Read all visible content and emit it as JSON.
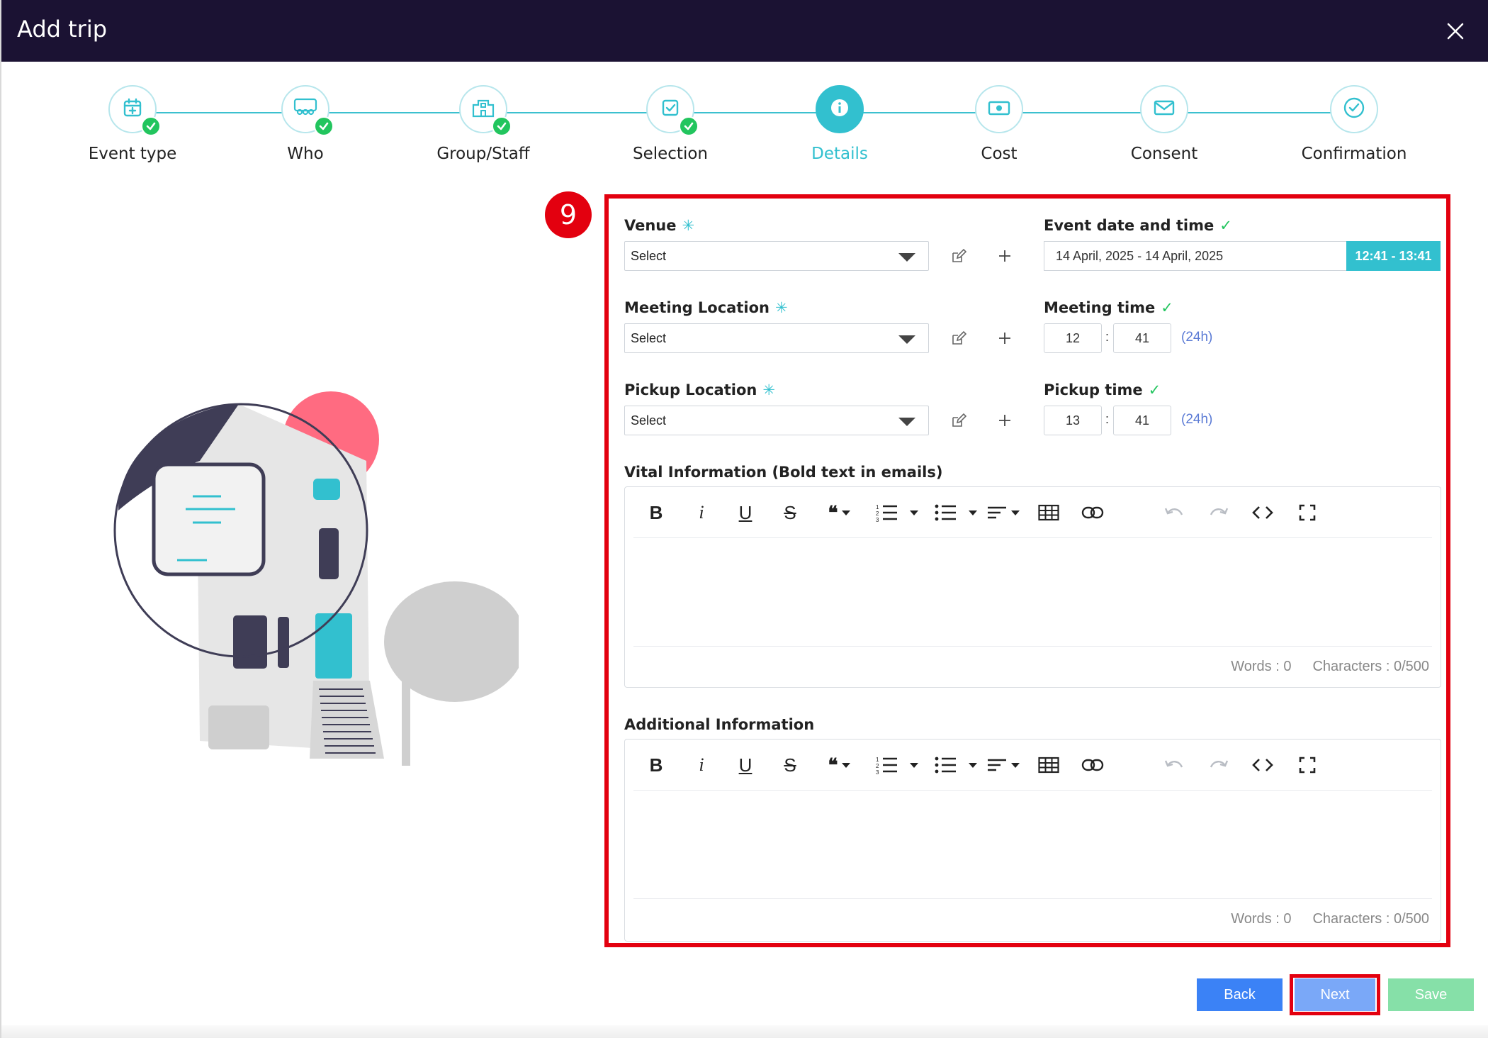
{
  "header": {
    "title": "Add trip"
  },
  "steps": [
    {
      "label": "Event type",
      "icon": "calendar-plus-icon",
      "done": true
    },
    {
      "label": "Who",
      "icon": "people-icon",
      "done": true
    },
    {
      "label": "Group/Staff",
      "icon": "building-icon",
      "done": true
    },
    {
      "label": "Selection",
      "icon": "checkbox-icon",
      "done": true
    },
    {
      "label": "Details",
      "icon": "info-icon",
      "active": true
    },
    {
      "label": "Cost",
      "icon": "money-icon"
    },
    {
      "label": "Consent",
      "icon": "envelope-icon"
    },
    {
      "label": "Confirmation",
      "icon": "check-circle-icon"
    }
  ],
  "marker": {
    "number": "9"
  },
  "form": {
    "venue": {
      "label": "Venue",
      "required": "✳",
      "value": "Select"
    },
    "meeting_location": {
      "label": "Meeting Location",
      "required": "✳",
      "value": "Select"
    },
    "pickup_location": {
      "label": "Pickup Location",
      "required": "✳",
      "value": "Select"
    },
    "event_date": {
      "label": "Event date and time",
      "ok": "✓",
      "value": "14 April, 2025 - 14 April, 2025",
      "time_range": "12:41  - 13:41"
    },
    "meeting_time": {
      "label": "Meeting time",
      "ok": "✓",
      "hour": "12",
      "minute": "41",
      "sep": ":",
      "format": "(24h)"
    },
    "pickup_time": {
      "label": "Pickup time",
      "ok": "✓",
      "hour": "13",
      "minute": "41",
      "sep": ":",
      "format": "(24h)"
    },
    "vital_info": {
      "label": "Vital Information (Bold text in emails)",
      "words": "Words : 0",
      "chars": "Characters : 0/500"
    },
    "additional_info": {
      "label": "Additional Information",
      "words": "Words : 0",
      "chars": "Characters : 0/500"
    }
  },
  "toolbar": {
    "bold": "B",
    "italic": "i",
    "underline": "U",
    "strike": "S",
    "quote": "❝"
  },
  "buttons": {
    "back": "Back",
    "next": "Next",
    "save": "Save"
  },
  "colors": {
    "header_bg": "#1b1233",
    "accent": "#32c0cf",
    "success": "#22c55e",
    "highlight": "#e3000f",
    "back_btn": "#3b82f6",
    "next_btn": "#7aa8f8",
    "save_btn": "#86e0a8"
  }
}
